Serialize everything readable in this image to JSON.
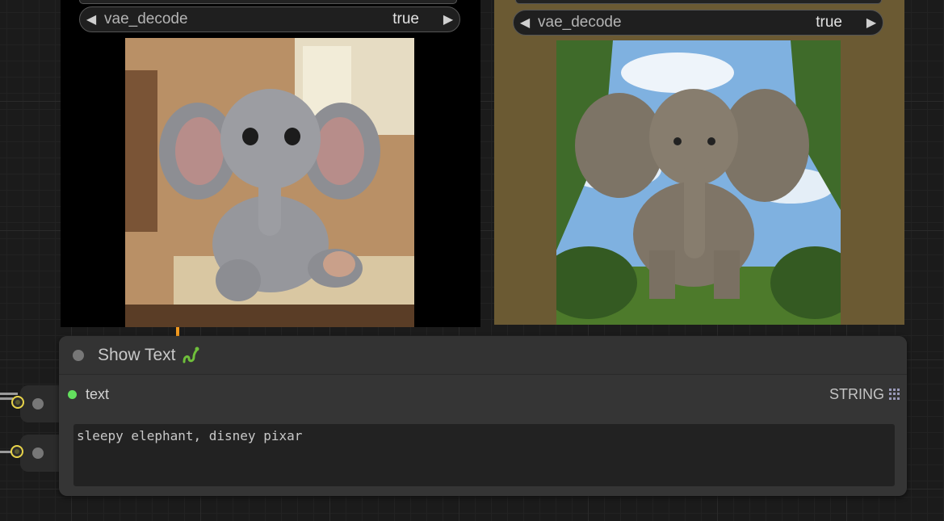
{
  "nodes": {
    "left_preview": {
      "widget": {
        "name": "vae_decode",
        "value": "true"
      }
    },
    "right_preview": {
      "widget": {
        "name": "vae_decode",
        "value": "true"
      }
    },
    "show_text": {
      "title": "Show Text",
      "title_icon": "snake-emoji-icon",
      "input": {
        "name": "text",
        "type": "STRING"
      },
      "textarea_value": "sleepy elephant, disney pixar"
    }
  },
  "colors": {
    "canvas_bg": "#1b1b1b",
    "node_bg": "#353535",
    "right_node_bg": "#6b5a33",
    "input_dot": "#63e05e",
    "socket_ring": "#e8d44a",
    "link_orange": "#f29a1f"
  },
  "icons": {
    "decrement": "triangle-left-icon",
    "increment": "triangle-right-icon",
    "type_grid": "grid-dots-icon"
  }
}
